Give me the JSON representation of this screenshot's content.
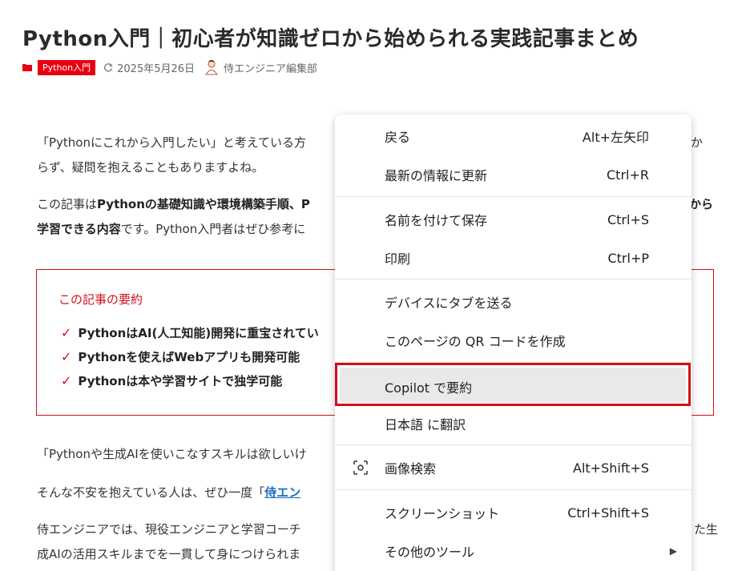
{
  "article": {
    "title": "Python入門｜初心者が知識ゼロから始められる実践記事まとめ",
    "category": "Python入門",
    "date": "2025年5月26日",
    "author": "侍エンジニア編集部",
    "intro1_line1": "「Pythonにこれから入門したい」と考えている方",
    "intro1_line1_end": "か",
    "intro1_line2": "らず、疑問を抱えることもありますよね。",
    "intro2_line1_a": "この記事は",
    "intro2_line1_b": "Pythonの基礎知識や環境構築手順、P",
    "intro2_line1_end": "から",
    "intro2_line2_a": "学習できる内容",
    "intro2_line2_b": "です。Python入門者はぜひ参考に",
    "p3": "「Pythonや生成AIを使いこなすスキルは欲しいけ",
    "p4_a": "そんな不安を抱えている人は、ぜひ一度「",
    "p4_link": "侍エン",
    "p5_line1": "侍エンジニアでは、現役エンジニアと学習コーチ",
    "p5_line1_end": "た生",
    "p5_line2": "成AIの活用スキルまでを一貫して身につけられま"
  },
  "summary": {
    "title": "この記事の要約",
    "items": [
      "PythonはAI(人工知能)開発に重宝されてい",
      "Pythonを使えばWebアプリも開発可能",
      "Pythonは本や学習サイトで独学可能"
    ]
  },
  "context_menu": {
    "items": [
      {
        "label": "戻る",
        "shortcut": "Alt+左矢印"
      },
      {
        "label": "最新の情報に更新",
        "shortcut": "Ctrl+R"
      },
      {
        "label": "名前を付けて保存",
        "shortcut": "Ctrl+S"
      },
      {
        "label": "印刷",
        "shortcut": "Ctrl+P"
      },
      {
        "label": "デバイスにタブを送る",
        "shortcut": ""
      },
      {
        "label": "このページの QR コードを作成",
        "shortcut": ""
      },
      {
        "label": "Copilot で要約",
        "shortcut": ""
      },
      {
        "label": "日本語 に翻訳",
        "shortcut": ""
      },
      {
        "label": "画像検索",
        "shortcut": "Alt+Shift+S",
        "icon": "image-search-icon"
      },
      {
        "label": "スクリーンショット",
        "shortcut": "Ctrl+Shift+S"
      },
      {
        "label": "その他のツール",
        "shortcut": "",
        "submenu": true
      }
    ]
  },
  "colors": {
    "accent_red": "#d0101a",
    "badge_red": "#e60012",
    "link_blue": "#1a6cc0",
    "menu_highlight": "#e9e9e9"
  }
}
